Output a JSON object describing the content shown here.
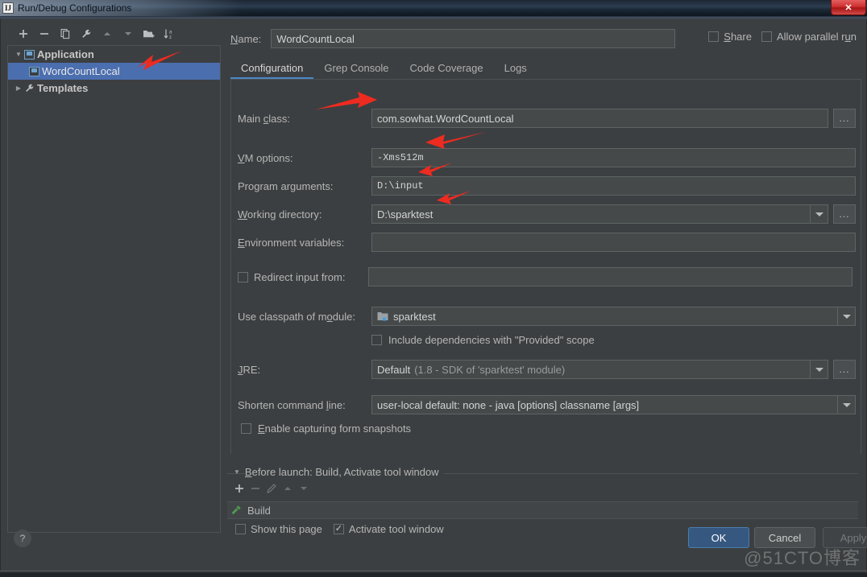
{
  "window": {
    "title": "Run/Debug Configurations",
    "close_label": "✕",
    "icon": "idea-logo-icon"
  },
  "sidebar": {
    "toolbar": [
      {
        "name": "add-configuration-button",
        "icon": "plus-icon",
        "label": "+"
      },
      {
        "name": "remove-configuration-button",
        "icon": "minus-icon",
        "label": "−"
      },
      {
        "name": "copy-configuration-button",
        "icon": "copy-icon",
        "label": "⧉"
      },
      {
        "name": "edit-templates-button",
        "icon": "wrench-icon",
        "label": "🔧"
      },
      {
        "name": "move-up-button",
        "icon": "arrow-up-icon",
        "label": "▲"
      },
      {
        "name": "move-down-button",
        "icon": "arrow-down-icon",
        "label": "▼"
      },
      {
        "name": "create-folder-button",
        "icon": "folder-add-icon",
        "label": "🗀"
      },
      {
        "name": "sort-configurations-button",
        "icon": "sort-az-icon",
        "label": "↓az"
      }
    ],
    "tree": [
      {
        "label": "Application",
        "expanded": true,
        "selected": false,
        "icon": "application-icon",
        "level": 0
      },
      {
        "label": "WordCountLocal",
        "expanded": false,
        "selected": true,
        "icon": "application-icon",
        "level": 1
      },
      {
        "label": "Templates",
        "expanded": false,
        "selected": false,
        "icon": "wrench-icon",
        "level": 0
      }
    ]
  },
  "header": {
    "name_label": "Name:",
    "name_value": "WordCountLocal",
    "share_label": "Share",
    "share_checked": false,
    "allow_parallel_label": "Allow parallel run",
    "allow_parallel_checked": false
  },
  "tabs": [
    {
      "label": "Configuration",
      "active": true
    },
    {
      "label": "Grep Console",
      "active": false
    },
    {
      "label": "Code Coverage",
      "active": false
    },
    {
      "label": "Logs",
      "active": false
    }
  ],
  "form": {
    "main_class": {
      "label": "Main class:",
      "value": "com.sowhat.WordCountLocal",
      "browse": "..."
    },
    "vm_options": {
      "label": "VM options:",
      "value": "-Xms512m",
      "expand_icon": "expand-icon",
      "macro_icon": "plus-icon"
    },
    "program_arguments": {
      "label": "Program arguments:",
      "value": "D:\\input",
      "expand_icon": "expand-icon",
      "macro_icon": "plus-icon"
    },
    "working_directory": {
      "label": "Working directory:",
      "value": "D:\\sparktest",
      "browse": "..."
    },
    "environment_variables": {
      "label": "Environment variables:",
      "value": "",
      "icon": "list-edit-icon"
    },
    "redirect_input": {
      "label": "Redirect input from:",
      "value": "",
      "checked": false,
      "icon": "folder-icon"
    },
    "use_classpath": {
      "label": "Use classpath of module:",
      "value": "sparktest",
      "icon": "module-icon"
    },
    "include_provided": {
      "label": "Include dependencies with \"Provided\" scope",
      "checked": false
    },
    "jre": {
      "label": "JRE:",
      "value": "Default",
      "value_hint": "(1.8 - SDK of 'sparktest' module)",
      "browse": "..."
    },
    "shorten_command_line": {
      "label": "Shorten command line:",
      "value": "user-local default: none - java [options] classname [args]"
    },
    "enable_capturing": {
      "label": "Enable capturing form snapshots",
      "checked": false
    }
  },
  "before_launch": {
    "header": "Before launch: Build, Activate tool window",
    "toolbar": [
      {
        "name": "add-task-button",
        "icon": "plus-icon",
        "label": "+",
        "enabled": true
      },
      {
        "name": "remove-task-button",
        "icon": "minus-icon",
        "label": "−",
        "enabled": false
      },
      {
        "name": "edit-task-button",
        "icon": "pencil-icon",
        "label": "✎",
        "enabled": false
      },
      {
        "name": "move-task-up-button",
        "icon": "arrow-up-icon",
        "label": "▲",
        "enabled": false
      },
      {
        "name": "move-task-down-button",
        "icon": "arrow-down-icon",
        "label": "▼",
        "enabled": false
      }
    ],
    "items": [
      {
        "label": "Build",
        "icon": "hammer-icon"
      }
    ],
    "show_this_page": {
      "label": "Show this page",
      "checked": false
    },
    "activate_tool_window": {
      "label": "Activate tool window",
      "checked": true
    }
  },
  "footer": {
    "help_label": "?",
    "ok_label": "OK",
    "cancel_label": "Cancel",
    "apply_label": "Apply",
    "apply_enabled": false
  },
  "watermark": "@51CTO博客",
  "colors": {
    "background": "#3c3f41",
    "field_background": "#45494a",
    "selection_blue": "#4b6eaf",
    "accent_blue": "#4a88c7",
    "ok_button": "#365880",
    "annotation_red": "#ee2b20",
    "build_icon_green": "#4f9a52"
  }
}
